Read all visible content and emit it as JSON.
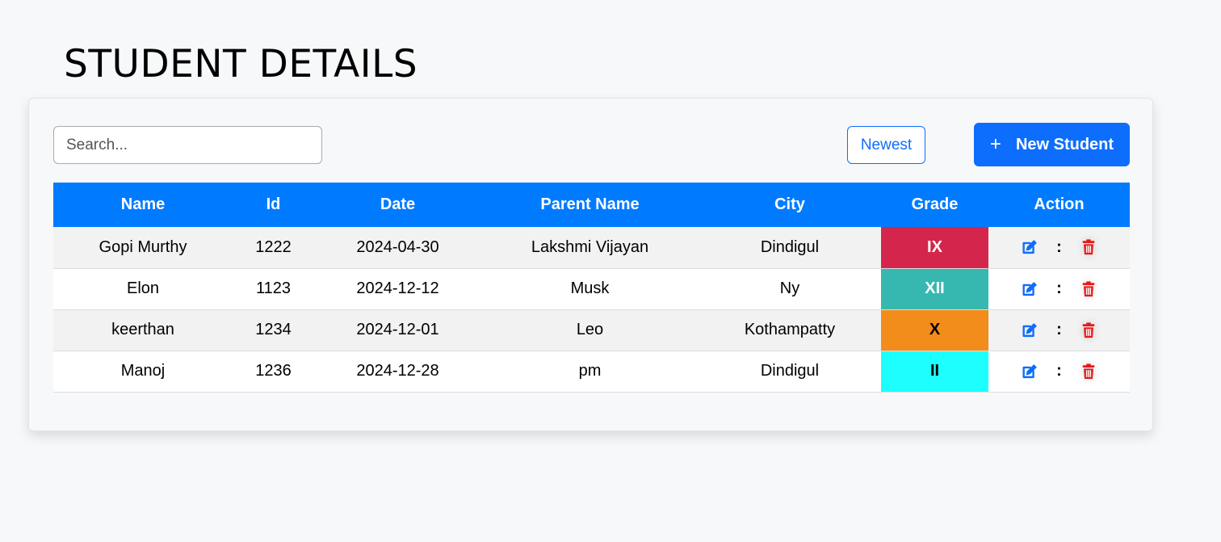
{
  "page": {
    "title": "STUDENT DETAILS"
  },
  "toolbar": {
    "search_placeholder": "Search...",
    "sort_label": "Newest",
    "new_label": "New Student",
    "new_icon": "plus-icon"
  },
  "table": {
    "headers": [
      "Name",
      "Id",
      "Date",
      "Parent Name",
      "City",
      "Grade",
      "Action"
    ],
    "rows": [
      {
        "name": "Gopi Murthy",
        "id": "1222",
        "date": "2024-04-30",
        "parent": "Lakshmi Vijayan",
        "city": "Dindigul",
        "grade": "IX",
        "grade_color": "#d4264c",
        "grade_text_dark": false
      },
      {
        "name": "Elon",
        "id": "1123",
        "date": "2024-12-12",
        "parent": "Musk",
        "city": "Ny",
        "grade": "XII",
        "grade_color": "#36b8b0",
        "grade_text_dark": false
      },
      {
        "name": "keerthan",
        "id": "1234",
        "date": "2024-12-01",
        "parent": "Leo",
        "city": "Kothampatty",
        "grade": "X",
        "grade_color": "#f28c1a",
        "grade_text_dark": true
      },
      {
        "name": "Manoj",
        "id": "1236",
        "date": "2024-12-28",
        "parent": "pm",
        "city": "Dindigul",
        "grade": "II",
        "grade_color": "#1dfefe",
        "grade_text_dark": true
      }
    ],
    "action_separator": ":",
    "edit_icon": "edit-icon",
    "delete_icon": "trash-icon"
  },
  "colors": {
    "accent": "#0d6efd",
    "header_bg": "#007bff",
    "delete": "#e8191a"
  }
}
